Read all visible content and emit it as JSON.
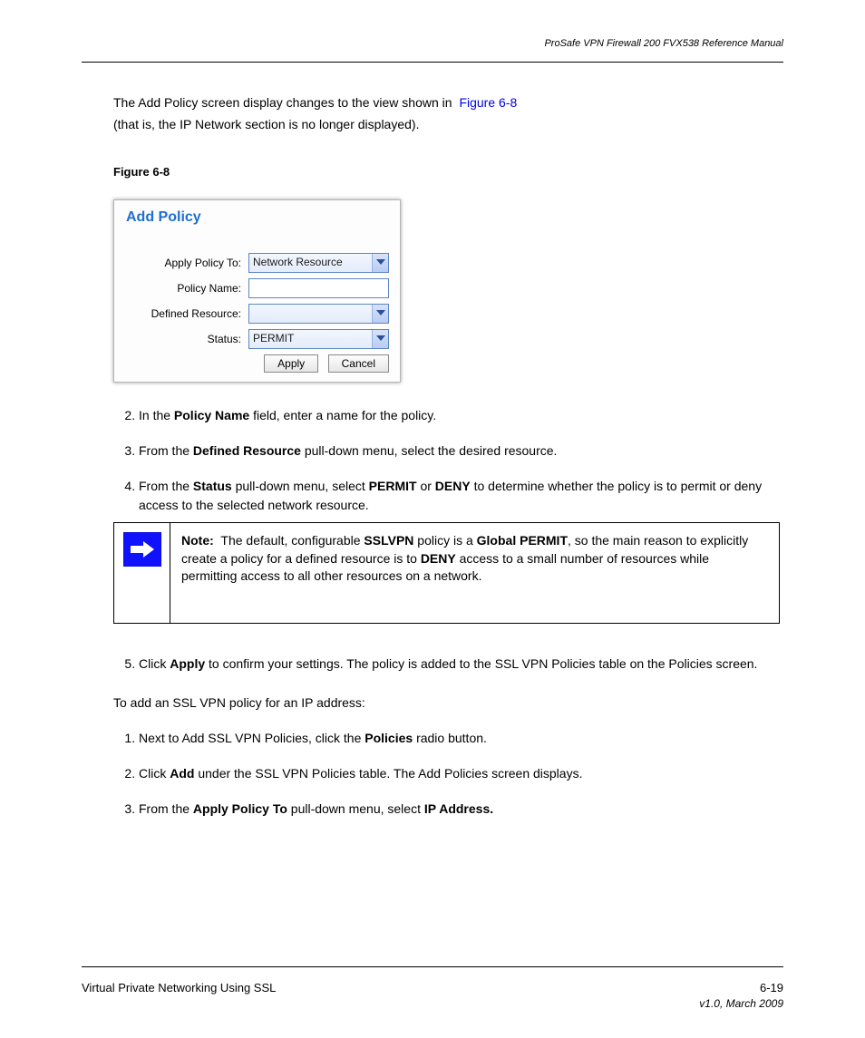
{
  "header": {
    "right": "ProSafe VPN Firewall 200 FVX538 Reference Manual"
  },
  "intro": {
    "line1": "The Add Policy screen display changes to the view shown in",
    "figref": "Figure 6-8",
    "line1_after": "",
    "line2": "(that is, the IP Network section is no longer displayed)."
  },
  "figure": {
    "label": "Figure 6-8",
    "caption": ""
  },
  "dialog": {
    "title": "Add Policy",
    "apply_label": "Apply Policy To:",
    "apply_value": "Network Resource",
    "policy_name_label": "Policy Name:",
    "policy_name_value": "",
    "defined_resource_label": "Defined Resource:",
    "defined_resource_value": "",
    "status_label": "Status:",
    "status_value": "PERMIT",
    "apply_btn": "Apply",
    "cancel_btn": "Cancel"
  },
  "steps_a": [
    "In the <b>Policy Name</b> field, enter a name for the policy.",
    "From the <b>Defined Resource</b> pull-down menu, select the desired resource.",
    "From the <b>Status</b> pull-down menu, select <b>PERMIT</b> or <b>DENY</b> to determine whether the policy is to permit or deny access to the selected network resource."
  ],
  "note": {
    "label": "Note:",
    "text": "The default, configurable <b>SSLVPN</b> policy is a <b>Global PERMIT</b>, so the main reason to explicitly create a policy for a defined resource is to <b>DENY</b> access to a small number of resources while permitting access to all other resources on a network."
  },
  "steps_b": [
    {
      "text": "Click <b>Apply</b> to confirm your settings. The policy is added to the SSL VPN Policies table on the Policies screen."
    }
  ],
  "steps_b_heading": "To add an SSL VPN policy for an IP address:",
  "steps_b2": [
    "Next to Add SSL VPN Policies, click the <b>Policies</b> radio button.",
    "Click <b>Add</b> under the SSL VPN Policies table. The Add Policies screen displays.",
    "From the <b>Apply Policy To</b> pull-down menu, select <b>IP Address.</b>"
  ],
  "footer": {
    "left": "Virtual Private Networking Using SSL",
    "right": "6-19",
    "line2_right": "v1.0, March 2009"
  }
}
